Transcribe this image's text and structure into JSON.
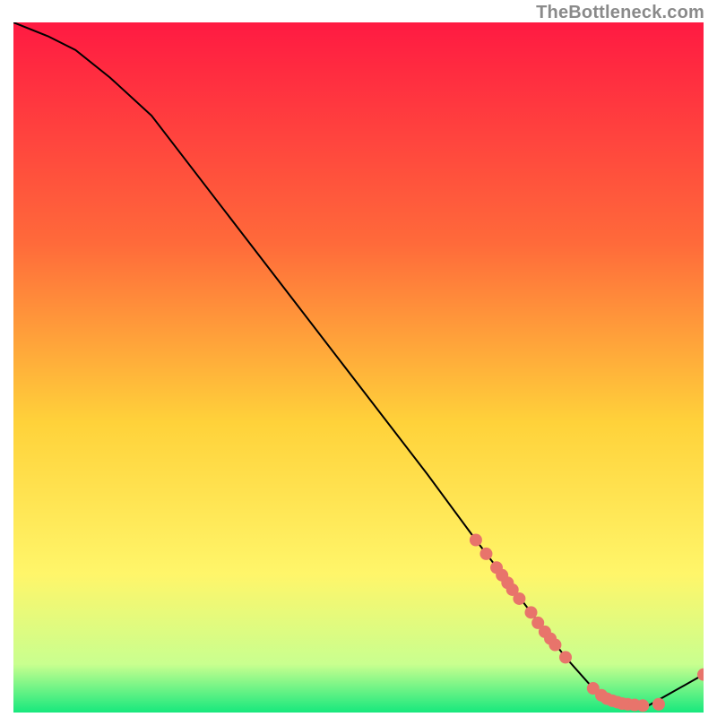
{
  "watermark": "TheBottleneck.com",
  "colors": {
    "gradient_top": "#ff1a42",
    "gradient_mid_upper": "#ff6a3a",
    "gradient_mid": "#ffd23a",
    "gradient_mid_lower": "#fff66a",
    "gradient_near_bottom": "#c9ff8f",
    "gradient_bottom": "#17e87d",
    "curve": "#000000",
    "marker": "#e8746b",
    "marker_stroke": "#e8746b"
  },
  "chart_data": {
    "type": "line",
    "title": "",
    "xlabel": "",
    "ylabel": "",
    "xlim": [
      0,
      100
    ],
    "ylim": [
      0,
      100
    ],
    "curve": {
      "x": [
        0,
        5,
        9,
        14,
        20,
        30,
        40,
        50,
        60,
        67,
        75,
        80,
        84,
        88,
        92,
        100
      ],
      "y": [
        100,
        98,
        96,
        92,
        86.5,
        73.5,
        60.5,
        47.5,
        34.5,
        25,
        14.5,
        8,
        3.5,
        1.2,
        1,
        5.5
      ]
    },
    "markers": [
      {
        "x": 67.0,
        "y": 25.0
      },
      {
        "x": 68.5,
        "y": 23.0
      },
      {
        "x": 70.0,
        "y": 21.0
      },
      {
        "x": 70.8,
        "y": 19.9
      },
      {
        "x": 71.6,
        "y": 18.8
      },
      {
        "x": 72.3,
        "y": 17.8
      },
      {
        "x": 73.3,
        "y": 16.5
      },
      {
        "x": 75.0,
        "y": 14.5
      },
      {
        "x": 76.0,
        "y": 13.0
      },
      {
        "x": 77.0,
        "y": 11.7
      },
      {
        "x": 77.8,
        "y": 10.7
      },
      {
        "x": 78.5,
        "y": 9.8
      },
      {
        "x": 80.0,
        "y": 8.0
      },
      {
        "x": 84.0,
        "y": 3.5
      },
      {
        "x": 85.2,
        "y": 2.5
      },
      {
        "x": 86.0,
        "y": 2.0
      },
      {
        "x": 86.8,
        "y": 1.7
      },
      {
        "x": 87.5,
        "y": 1.5
      },
      {
        "x": 88.2,
        "y": 1.3
      },
      {
        "x": 89.0,
        "y": 1.2
      },
      {
        "x": 90.0,
        "y": 1.1
      },
      {
        "x": 91.2,
        "y": 1.0
      },
      {
        "x": 93.5,
        "y": 1.2
      },
      {
        "x": 100.0,
        "y": 5.5
      }
    ]
  }
}
